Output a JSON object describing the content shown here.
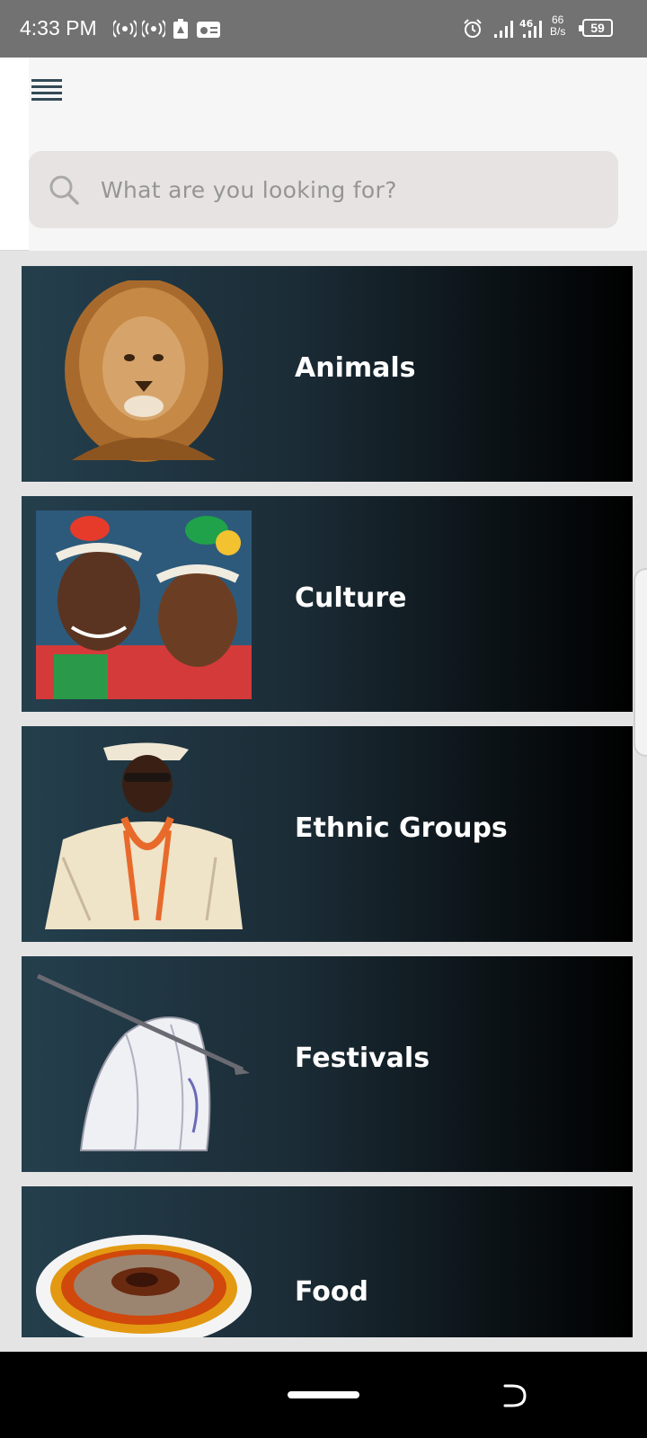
{
  "status_bar": {
    "time": "4:33 PM",
    "net_top": "46",
    "speed_value": "66",
    "speed_unit": "B/s",
    "battery": "59",
    "icons": [
      "hotspot-icon",
      "hotspot-icon",
      "download-icon",
      "radio-icon",
      "alarm-icon",
      "signal-icon",
      "signal-icon"
    ]
  },
  "header": {
    "menu_icon": "hamburger-menu-icon",
    "search_placeholder": "What are you looking for?"
  },
  "categories": [
    {
      "label": "Animals",
      "image": "lion-image"
    },
    {
      "label": "Culture",
      "image": "culture-image"
    },
    {
      "label": "Ethnic Groups",
      "image": "ethnic-group-image"
    },
    {
      "label": "Festivals",
      "image": "festival-image"
    },
    {
      "label": "Food",
      "image": "food-image"
    }
  ],
  "colors": {
    "status_bar": "#727272",
    "card_start": "#243f4d",
    "card_end": "#000000",
    "menu_icon": "#334a56",
    "search_bg": "#e7e3e3"
  }
}
